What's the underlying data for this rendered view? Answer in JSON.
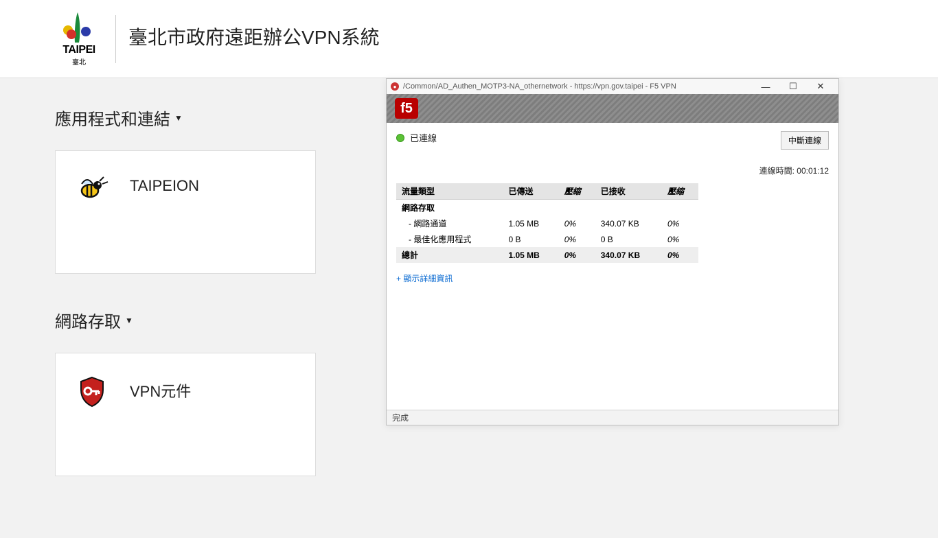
{
  "header": {
    "logo_text": "TAIPEI",
    "logo_sub": "臺北",
    "title": "臺北市政府遠距辦公VPN系統"
  },
  "sections": {
    "apps_title": "應用程式和連結",
    "apps_item": "TAIPEION",
    "net_title": "網路存取",
    "net_item": "VPN元件"
  },
  "win": {
    "title": "/Common/AD_Authen_MOTP3-NA_othernetwork - https://vpn.gov.taipei - F5 VPN",
    "f5": "f5",
    "connected": "已連線",
    "disconnect": "中斷連線",
    "time_label": "連線時間: ",
    "time_value": "00:01:12",
    "cols": {
      "type": "流量類型",
      "sent": "已傳送",
      "comp1": "壓縮",
      "recv": "已接收",
      "comp2": "壓縮"
    },
    "group": "網路存取",
    "rows": [
      {
        "label": "- 網路通道",
        "sent": "1.05 MB",
        "c1": "0%",
        "recv": "340.07 KB",
        "c2": "0%"
      },
      {
        "label": "- 最佳化應用程式",
        "sent": "0 B",
        "c1": "0%",
        "recv": "0 B",
        "c2": "0%"
      }
    ],
    "total": {
      "label": "總計",
      "sent": "1.05 MB",
      "c1": "0%",
      "recv": "340.07 KB",
      "c2": "0%"
    },
    "details": "+ 顯示詳細資訊",
    "status": "完成"
  }
}
